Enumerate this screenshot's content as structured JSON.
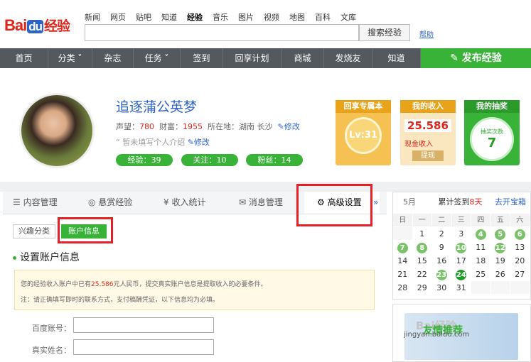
{
  "logo": {
    "bai": "Bai",
    "du": "du",
    "jy": "经验"
  },
  "topnav": [
    "新闻",
    "网页",
    "贴吧",
    "知道",
    "经验",
    "音乐",
    "图片",
    "视频",
    "地图",
    "百科",
    "文库"
  ],
  "search": {
    "button": "搜索经验",
    "help": "帮助"
  },
  "mainnav": [
    {
      "label": "首页"
    },
    {
      "label": "分类 ˅"
    },
    {
      "label": "杂志"
    },
    {
      "label": "任务 ˅"
    },
    {
      "label": "签到"
    },
    {
      "label": "回享计划"
    },
    {
      "label": "商城"
    },
    {
      "label": "发烧友"
    },
    {
      "label": "知道"
    }
  ],
  "publish": "发布经验",
  "profile": {
    "name": "追逐蒲公英梦",
    "rep_label": "声望：",
    "rep": "780",
    "wealth_label": "财富：",
    "wealth": "1955",
    "loc_label": "所在地：",
    "loc": "湖南 长沙",
    "edit": "修改",
    "intro": "暂未填写个人介绍",
    "pills": [
      "经验：39",
      "关注：10",
      "粉丝：14"
    ]
  },
  "cards": {
    "c1": {
      "title": "回享专属本",
      "level": "Lv:31"
    },
    "c2": {
      "title": "我的收入",
      "money": "25.586",
      "sub": "现金收入",
      "btn": "提现"
    },
    "c3": {
      "title": "我的抽奖",
      "sub": "抽奖次数",
      "count": "7"
    }
  },
  "tabs": [
    "内容管理",
    "悬赏经验",
    "收入统计",
    "消息管理",
    "高级设置"
  ],
  "tabs_more": "»",
  "subtabs": [
    "兴趣分类",
    "账户信息"
  ],
  "section": {
    "title": "设置账户信息",
    "n1a": "您的经验收入账户中已有",
    "n1b": "25.586",
    "n1c": "元人民币，提交真实账户信息是提取收入的必要条件。",
    "n2": "注：请正确填写即时的联系方式，支付稿酬凭证，以下信息均为必填。"
  },
  "form": [
    "百度账号：",
    "真实姓名："
  ],
  "calendar": {
    "month": "5月",
    "signin_a": "累计签到",
    "signin_b": "8天",
    "link": "去开宝箱",
    "weekdays": [
      "日",
      "一",
      "二",
      "三",
      "四",
      "五",
      "六"
    ],
    "rows": [
      [
        "",
        "",
        "",
        "",
        "",
        "",
        ""
      ],
      [
        "",
        "1",
        "2",
        "3",
        "4",
        "5",
        "6"
      ],
      [
        "7",
        "8",
        "9",
        "10",
        "11",
        "12",
        "13"
      ],
      [
        "14",
        "15",
        "16",
        "17",
        "18",
        "19",
        "20"
      ],
      [
        "21",
        "22",
        "23",
        "24",
        "25",
        "26",
        "27"
      ],
      [
        "28",
        "29",
        "30",
        "31",
        "",
        "",
        ""
      ]
    ],
    "signed": [
      "4",
      "5",
      "6",
      "7",
      "8",
      "10",
      "12",
      "23"
    ],
    "today": "24"
  },
  "ad": {
    "brand": "Bai经验",
    "site": "jingyan.baidu.com",
    "word": "友情推荐"
  }
}
